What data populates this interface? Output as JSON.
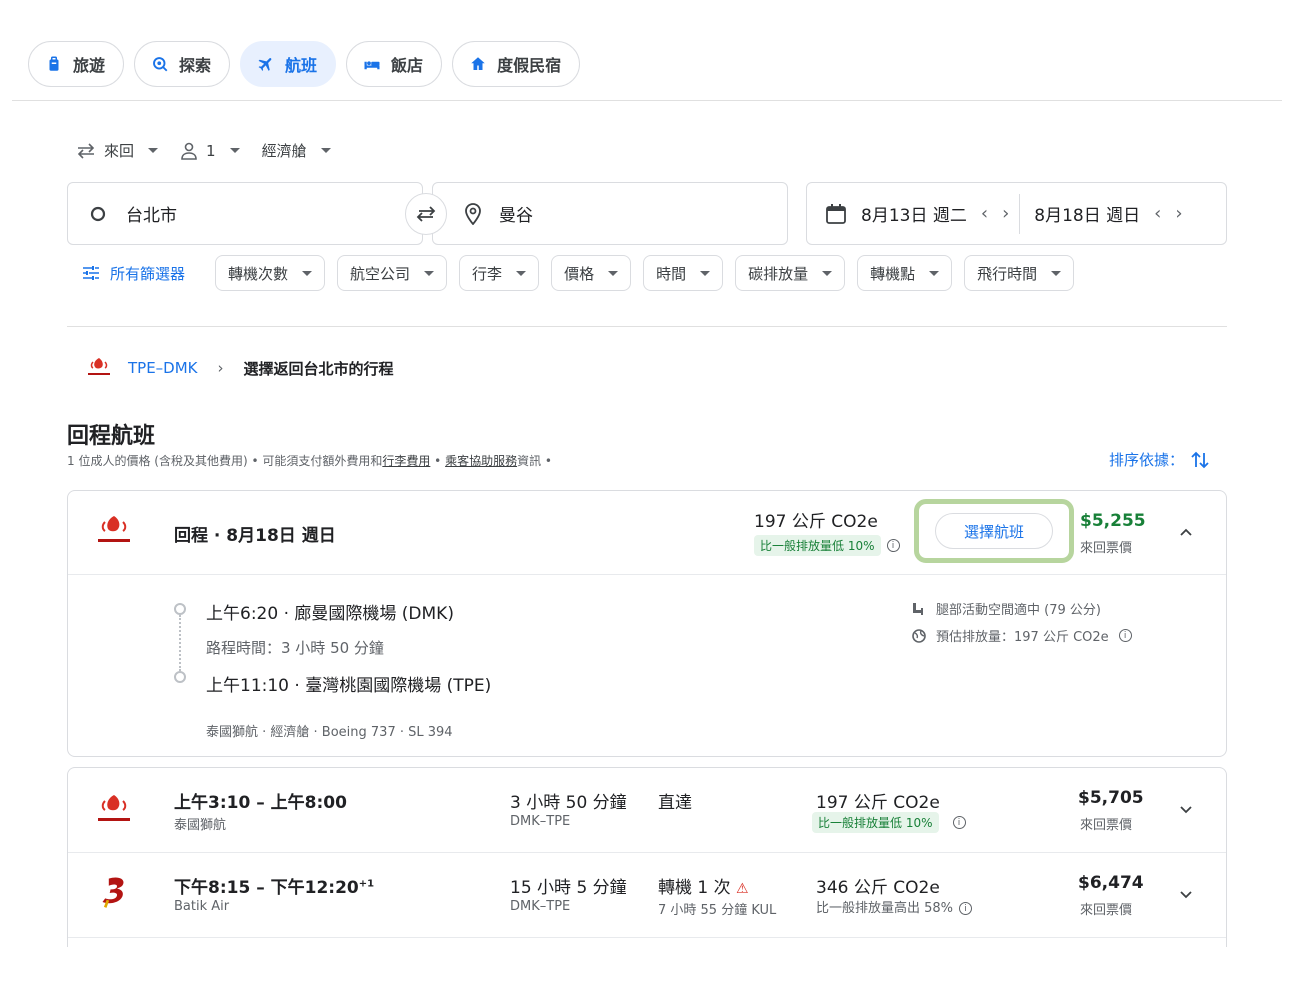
{
  "topnav": [
    {
      "label": "旅遊",
      "icon": "suitcase-icon",
      "active": false
    },
    {
      "label": "探索",
      "icon": "explore-icon",
      "active": false
    },
    {
      "label": "航班",
      "icon": "airplane-icon",
      "active": true
    },
    {
      "label": "飯店",
      "icon": "bed-icon",
      "active": false
    },
    {
      "label": "度假民宿",
      "icon": "house-icon",
      "active": false
    }
  ],
  "trip_options": {
    "trip_type": "來回",
    "passengers": "1",
    "cabin": "經濟艙"
  },
  "search": {
    "origin": "台北市",
    "destination": "曼谷",
    "depart_date": "8月13日 週二",
    "return_date": "8月18日 週日"
  },
  "filters": {
    "all_filters": "所有篩選器",
    "chips": [
      "轉機次數",
      "航空公司",
      "行李",
      "價格",
      "時間",
      "碳排放量",
      "轉機點",
      "飛行時間"
    ]
  },
  "breadcrumb": {
    "route": "TPE–DMK",
    "current": "選擇返回台北市的行程"
  },
  "section": {
    "title": "回程航班",
    "subtitle_a": "1 位成人的價格 (含稅及其他費用) • 可能須支付額外費用和",
    "subtitle_link1": "行李費用",
    "subtitle_b": " • ",
    "subtitle_link2": "乘客協助服務",
    "subtitle_c": "資訊 •",
    "sort_label": "排序依據："
  },
  "selected": {
    "title": "回程 · 8月18日 週日",
    "co2": "197 公斤 CO2e",
    "co2_badge": "比一般排放量低 10%",
    "select_label": "選擇航班",
    "price": "$5,255",
    "price_sub": "來回票價",
    "depart": "上午6:20 · 廊曼國際機場 (DMK)",
    "duration": "路程時間：3 小時 50 分鐘",
    "arrive": "上午11:10 · 臺灣桃園國際機場 (TPE)",
    "footnote": "泰國獅航 · 經濟艙 · Boeing 737 · SL 394",
    "legroom": "腿部活動空間適中 (79 公分)",
    "emission": "預估排放量：197 公斤 CO2e",
    "accent_green": "#b7d59e"
  },
  "results": [
    {
      "times": "上午3:10 – 上午8:00",
      "times_sup": "",
      "airline": "泰國獅航",
      "duration": "3 小時 50 分鐘",
      "route": "DMK–TPE",
      "stops": "直達",
      "stops_sub": "",
      "co2": "197 公斤 CO2e",
      "co2_note": "比一般排放量低 10%",
      "co2_badge": true,
      "price": "$5,705",
      "price_sub": "來回票價"
    },
    {
      "times": "下午8:15 – 下午12:20",
      "times_sup": "+1",
      "airline": "Batik Air",
      "duration": "15 小時 5 分鐘",
      "route": "DMK–TPE",
      "stops": "轉機 1 次",
      "stops_sub": "7 小時 55 分鐘 KUL",
      "co2": "346 公斤 CO2e",
      "co2_note": "比一般排放量高出 58%",
      "co2_badge": false,
      "price": "$6,474",
      "price_sub": "來回票價"
    }
  ]
}
